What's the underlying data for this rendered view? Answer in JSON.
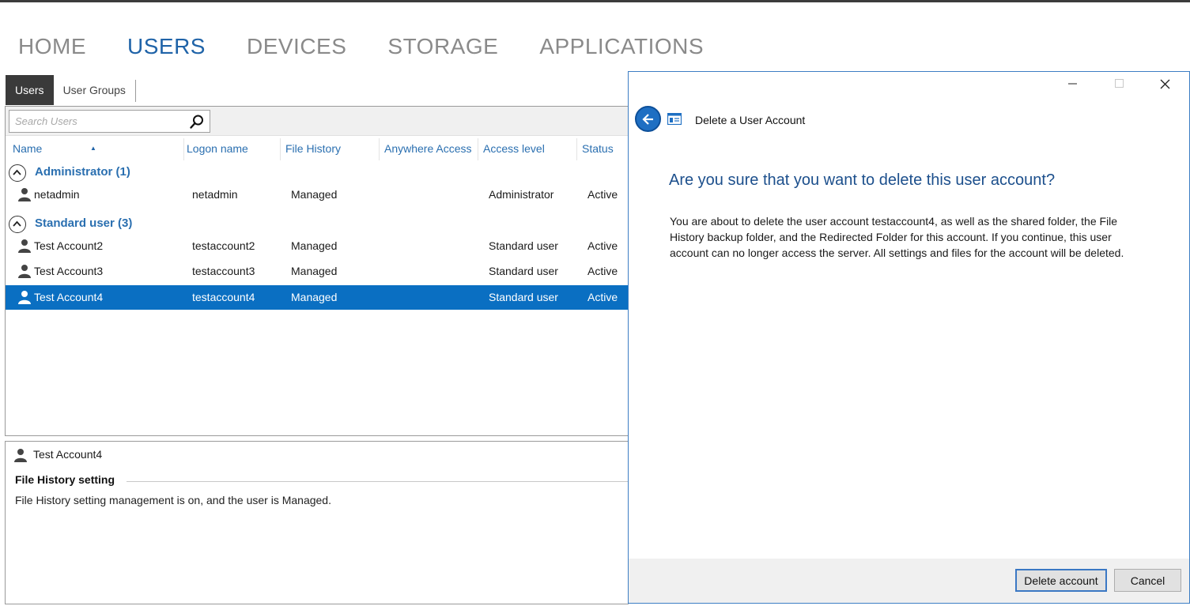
{
  "nav": {
    "items": [
      {
        "label": "HOME",
        "active": false
      },
      {
        "label": "USERS",
        "active": true
      },
      {
        "label": "DEVICES",
        "active": false
      },
      {
        "label": "STORAGE",
        "active": false
      },
      {
        "label": "APPLICATIONS",
        "active": false
      }
    ]
  },
  "tabs": {
    "users": "Users",
    "user_groups": "User Groups"
  },
  "search": {
    "placeholder": "Search Users",
    "value": ""
  },
  "columns": {
    "name": "Name",
    "logon": "Logon name",
    "file_history": "File History",
    "anywhere": "Anywhere Access",
    "access_level": "Access level",
    "status": "Status"
  },
  "groups": [
    {
      "label": "Administrator  (1)",
      "rows": [
        {
          "name": "netadmin",
          "logon": "netadmin",
          "file_history": "Managed",
          "anywhere": "",
          "access_level": "Administrator",
          "status": "Active",
          "selected": false
        }
      ]
    },
    {
      "label": "Standard user  (3)",
      "rows": [
        {
          "name": "Test Account2",
          "logon": "testaccount2",
          "file_history": "Managed",
          "anywhere": "",
          "access_level": "Standard user",
          "status": "Active",
          "selected": false
        },
        {
          "name": "Test Account3",
          "logon": "testaccount3",
          "file_history": "Managed",
          "anywhere": "",
          "access_level": "Standard user",
          "status": "Active",
          "selected": false
        },
        {
          "name": "Test Account4",
          "logon": "testaccount4",
          "file_history": "Managed",
          "anywhere": "",
          "access_level": "Standard user",
          "status": "Active",
          "selected": true
        }
      ]
    }
  ],
  "details": {
    "user_name": "Test Account4",
    "section_heading": "File History setting",
    "section_text": "File History setting management is on, and the user is Managed."
  },
  "dialog": {
    "title": "Delete a User Account",
    "heading": "Are you sure that you want to delete this user account?",
    "body": "You are about to delete the user account testaccount4, as well as the shared folder, the File History backup folder, and the Redirected Folder for this account. If you continue, this user account can no longer access the server. All settings and files for the account will be deleted.",
    "delete_label": "Delete account",
    "cancel_label": "Cancel"
  },
  "colors": {
    "accent": "#1f63a8",
    "selection": "#0a6fc2",
    "dialog_border": "#3d7ec4"
  },
  "icons": [
    "search-icon",
    "user-icon",
    "collapse-chevron-icon",
    "back-arrow-icon",
    "app-window-icon",
    "minimize-icon",
    "maximize-icon",
    "close-icon"
  ]
}
